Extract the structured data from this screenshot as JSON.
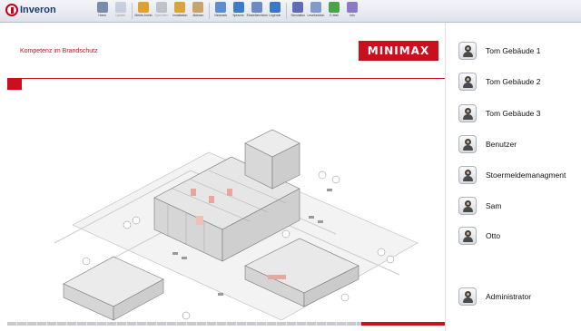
{
  "app": {
    "title": "Inveron"
  },
  "toolbar": {
    "items": [
      {
        "label": "Home",
        "icon": "home-icon",
        "color": "#7a8bb0",
        "disabled": false
      },
      {
        "label": "Update",
        "icon": "update-icon",
        "color": "#9aa7c3",
        "disabled": true
      },
      {
        "label": "Melde-Archiv",
        "icon": "archive-icon",
        "color": "#e0a030",
        "disabled": false
      },
      {
        "label": "Speichern",
        "icon": "save-icon",
        "color": "#8a8f9a",
        "disabled": true
      },
      {
        "label": "Installation",
        "icon": "installation-icon",
        "color": "#d8a43c",
        "disabled": false
      },
      {
        "label": "Ablesen",
        "icon": "reading-icon",
        "color": "#c7a46a",
        "disabled": false
      },
      {
        "label": "Netzwerk",
        "icon": "network-icon",
        "color": "#5d8fd0",
        "disabled": false
      },
      {
        "label": "Sprache",
        "icon": "language-icon",
        "color": "#3d7cc9",
        "disabled": false
      },
      {
        "label": "Einstellarchiven",
        "icon": "settings-archive-icon",
        "color": "#6c8bc4",
        "disabled": false
      },
      {
        "label": "Legende",
        "icon": "legend-icon",
        "color": "#3a78c8",
        "disabled": false
      },
      {
        "label": "Simulation",
        "icon": "simulation-icon",
        "color": "#5c6fb5",
        "disabled": false
      },
      {
        "label": "Lesefunktion",
        "icon": "read-function-icon",
        "color": "#7f9bc7",
        "disabled": false
      },
      {
        "label": "E-Mail",
        "icon": "email-icon",
        "color": "#4aa34a",
        "disabled": false
      },
      {
        "label": "Info",
        "icon": "info-icon",
        "color": "#8a7bc4",
        "disabled": false
      }
    ]
  },
  "main": {
    "tagline": "Kompetenz im Brandschutz",
    "brand": "MINIMAX",
    "accent_color": "#c8101e",
    "progress_fraction": 0.19
  },
  "sidebar": {
    "users": [
      {
        "name": "Tom Gebäude 1"
      },
      {
        "name": "Tom Gebäude 2"
      },
      {
        "name": "Tom Gebäude 3"
      },
      {
        "name": "Benutzer"
      },
      {
        "name": "Stoermeldemanagment"
      },
      {
        "name": "Sam"
      },
      {
        "name": "Otto"
      }
    ],
    "admin": {
      "name": "Administrator"
    }
  }
}
